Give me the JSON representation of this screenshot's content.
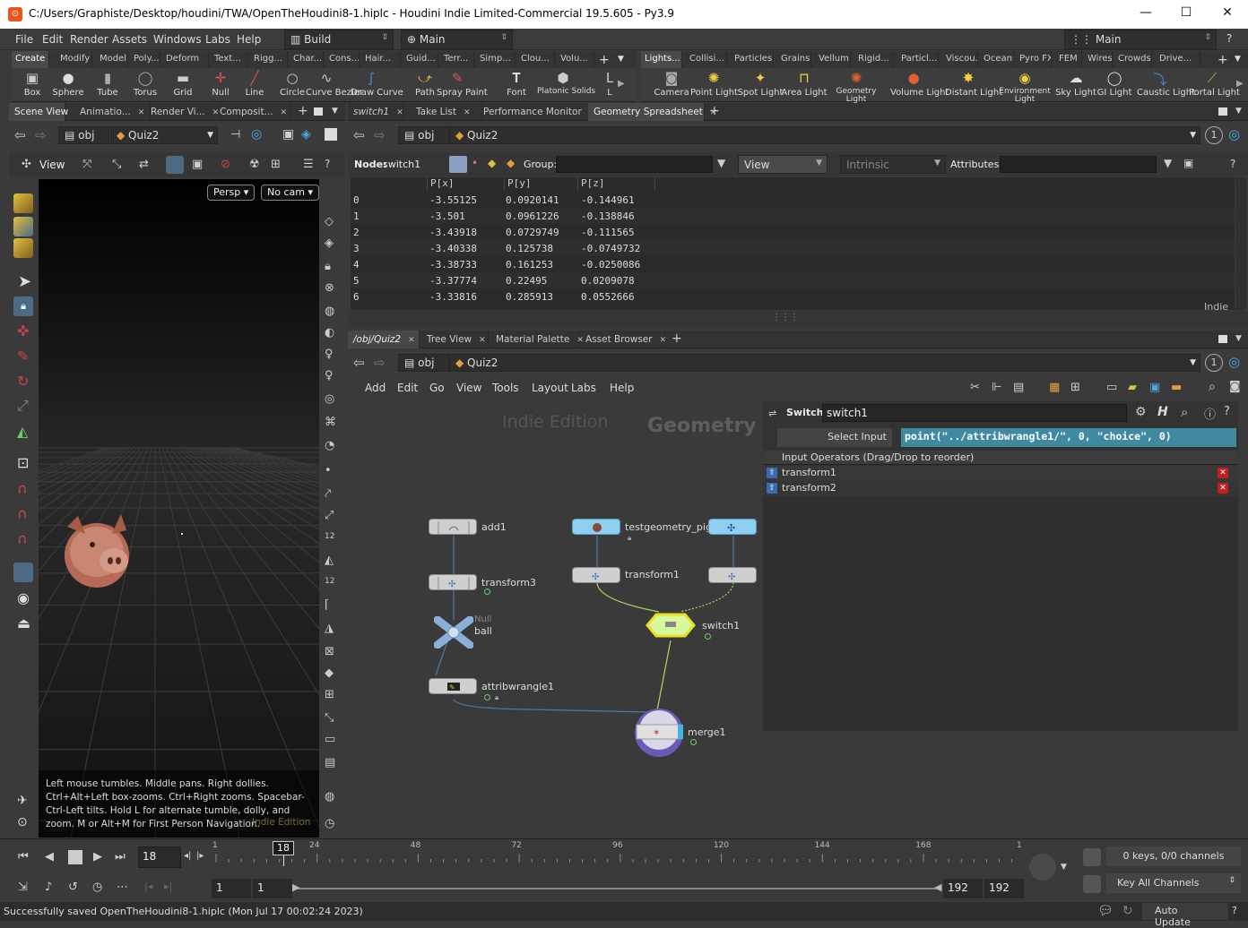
{
  "window": {
    "title": "C:/Users/Graphiste/Desktop/houdini/TWA/OpenTheHoudini8-1.hiplc - Houdini Indie Limited-Commercial 19.5.605 - Py3.9",
    "min": "—",
    "max": "☐",
    "close": "✕"
  },
  "menu": {
    "items": [
      "File",
      "Edit",
      "Render",
      "Assets",
      "Windows",
      "Labs",
      "Help"
    ],
    "desktop": "Build",
    "context": "Main",
    "right_combo": "Main",
    "help": "?"
  },
  "shelf_left": {
    "tabs": [
      "Create",
      "Modify",
      "Model",
      "Poly...",
      "Deform",
      "Text...",
      "Rigg...",
      "Char...",
      "Cons...",
      "Hair...",
      "Guid...",
      "Terr...",
      "Simp...",
      "Clou...",
      "Volu..."
    ],
    "tools": [
      "Box",
      "Sphere",
      "Tube",
      "Torus",
      "Grid",
      "Null",
      "Line",
      "Circle",
      "Curve Bezier",
      "Draw Curve",
      "Path",
      "Spray Paint",
      "Font",
      "Platonic Solids",
      "L"
    ]
  },
  "shelf_right": {
    "tabs": [
      "Lights...",
      "Collisi...",
      "Particles",
      "Grains",
      "Vellum",
      "Rigid...",
      "Particl...",
      "Viscou...",
      "Oceans",
      "Pyro FX",
      "FEM",
      "Wires",
      "Crowds",
      "Drive..."
    ],
    "tools": [
      "Camera",
      "Point Light",
      "Spot Light",
      "Area Light",
      "Geometry Light",
      "Volume Light",
      "Distant Light",
      "Environment Light",
      "Sky Light",
      "GI Light",
      "Caustic Light",
      "Portal Light"
    ]
  },
  "left_pane": {
    "tabs": [
      "Scene View",
      "Animatio...",
      "Render Vi...",
      "Composit..."
    ],
    "path_root": "obj",
    "path_node": "Quiz2",
    "view_label": "View",
    "persp": "Persp",
    "cam": "No cam",
    "help_text": "Left mouse tumbles. Middle pans. Right dollies. Ctrl+Alt+Left box-zooms. Ctrl+Right zooms. Spacebar-Ctrl-Left tilts. Hold L for alternate tumble, dolly, and zoom.    M or Alt+M for First Person Navigation.",
    "watermark": "Indie Edition"
  },
  "top_right_pane": {
    "tabs": [
      "switch1",
      "Take List",
      "Performance Monitor",
      "Geometry Spreadsheet"
    ],
    "path_root": "obj",
    "path_node": "Quiz2",
    "badge": "1",
    "node_label": "Node:",
    "node_value": "switch1",
    "group_label": "Group:",
    "view_combo": "View",
    "intrinsics": "Intrinsic",
    "attributes_label": "Attributes:",
    "indie": "Indie"
  },
  "spreadsheet": {
    "headers": [
      "P[x]",
      "P[y]",
      "P[z]"
    ],
    "rows": [
      [
        "0",
        "-3.55125",
        "0.0920141",
        "-0.144961"
      ],
      [
        "1",
        "-3.501",
        "0.0961226",
        "-0.138846"
      ],
      [
        "2",
        "-3.43918",
        "0.0729749",
        "-0.111565"
      ],
      [
        "3",
        "-3.40338",
        "0.125738",
        "-0.0749732"
      ],
      [
        "4",
        "-3.38733",
        "0.161253",
        "-0.0250086"
      ],
      [
        "5",
        "-3.37774",
        "0.22495",
        "0.0209078"
      ],
      [
        "6",
        "-3.33816",
        "0.285913",
        "0.0552666"
      ]
    ]
  },
  "bottom_right_pane": {
    "tabs": [
      "/obj/Quiz2",
      "Tree View",
      "Material Palette",
      "Asset Browser"
    ],
    "path_root": "obj",
    "path_node": "Quiz2",
    "badge": "1",
    "menu": [
      "Add",
      "Edit",
      "Go",
      "View",
      "Tools",
      "Layout",
      "Labs",
      "Help"
    ],
    "watermark_edition": "Indie Edition",
    "watermark_context": "Geometry"
  },
  "network": {
    "nodes": {
      "add": "add1",
      "testgeo": "testgeometry_pighead",
      "transform1": "transform1",
      "transform3": "transform3",
      "null_type": "Null",
      "ball": "ball",
      "switch": "switch1",
      "wrangle": "attribwrangle1",
      "merge": "merge1"
    }
  },
  "params": {
    "type": "Switch",
    "name": "switch1",
    "select_input_label": "Select Input",
    "select_input_value": "point(\"../attribwrangle1/\", 0, \"choice\", 0)",
    "inputs_header": "Input Operators (Drag/Drop to reorder)",
    "inputs": [
      "transform1",
      "transform2"
    ]
  },
  "timeline": {
    "current_frame": "18",
    "marker": "18",
    "ticks": [
      "1",
      "24",
      "48",
      "72",
      "96",
      "120",
      "144",
      "168",
      "1"
    ],
    "start": "1",
    "range_start": "1",
    "range_end": "192",
    "end": "192",
    "keys": "0 keys, 0/0 channels",
    "key_channels": "Key All Channels"
  },
  "status": {
    "message": "Successfully saved OpenTheHoudini8-1.hiplc (Mon Jul 17 00:02:24 2023)",
    "auto_update": "Auto Update"
  }
}
